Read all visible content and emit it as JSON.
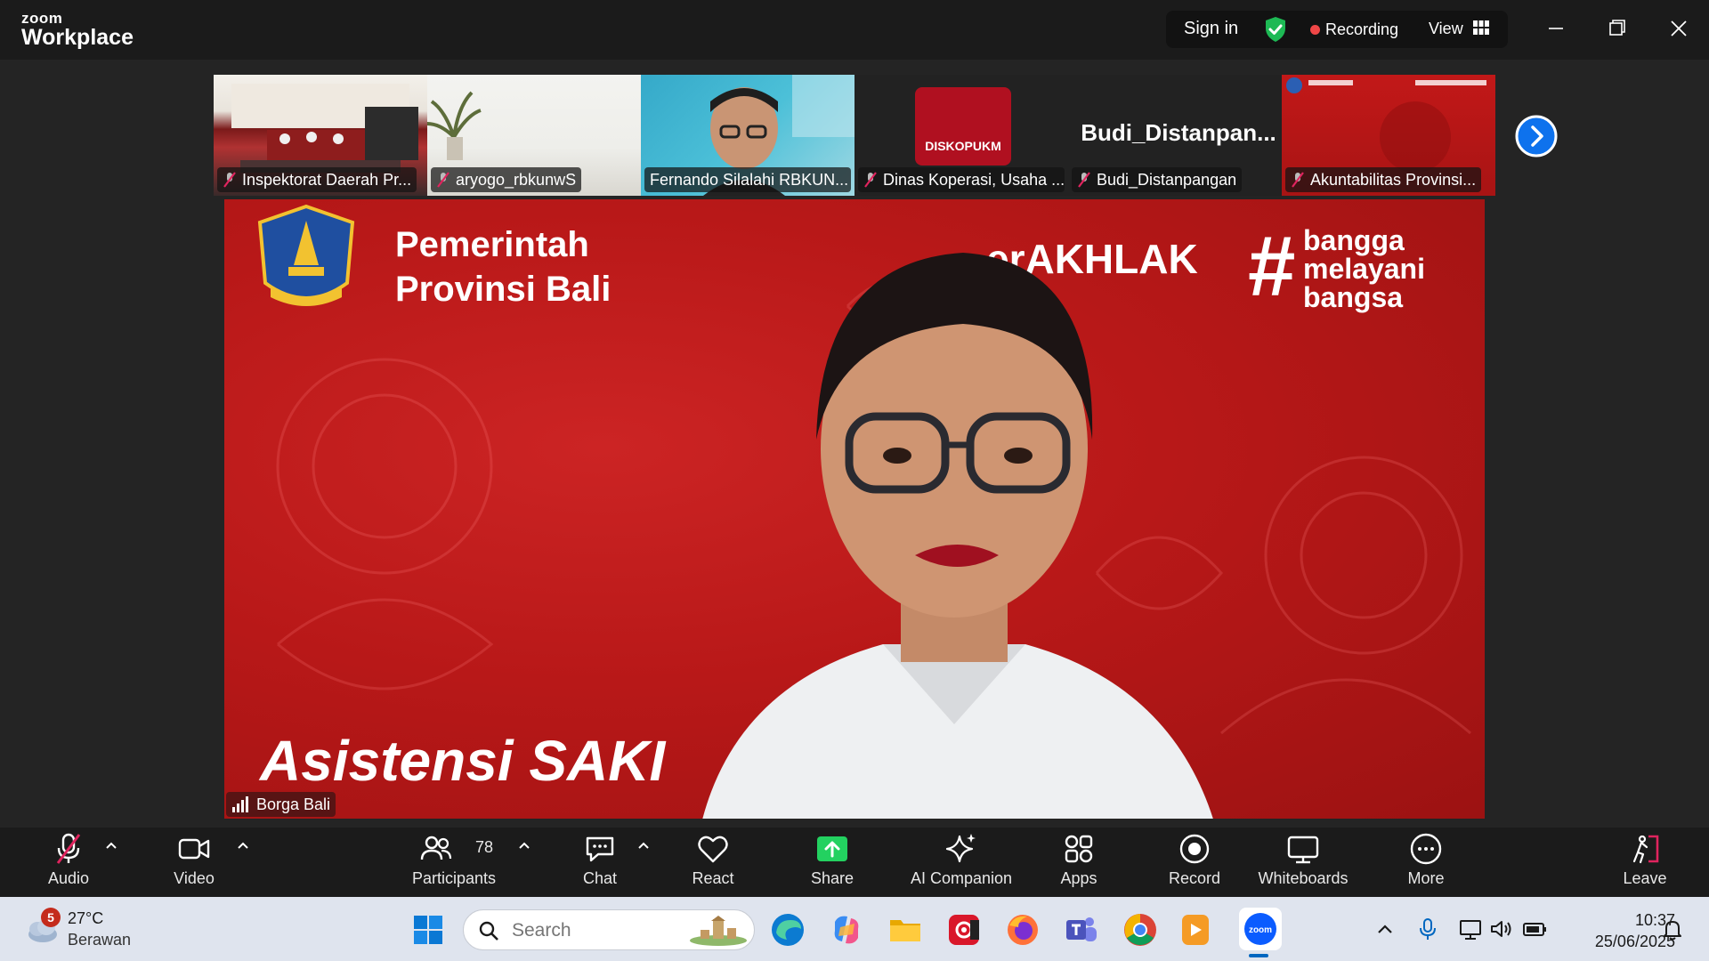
{
  "titlebar": {
    "brand_small": "zoom",
    "brand_big": "Workplace",
    "sign_in": "Sign in",
    "recording": "Recording",
    "view": "View",
    "colors": {
      "shield": "#1db954",
      "record_dot": "#f04747"
    }
  },
  "thumbnails": [
    {
      "name": "Inspektorat Daerah Pr..."
    },
    {
      "name": "aryogo_rbkunwS"
    },
    {
      "name": "Fernando Silalahi RBKUN..."
    },
    {
      "name": "Dinas Koperasi, Usaha ...",
      "logo_text": "DISKOPUKM"
    },
    {
      "name": "Budi_Distanpangan",
      "big_name": "Budi_Distanpan..."
    },
    {
      "name": "Akuntabilitas Provinsi..."
    }
  ],
  "main_video": {
    "speaker": "Borga Bali",
    "slide": {
      "line1": "Pemerintah",
      "line2": "Provinsi Bali",
      "berakhlak": "erAKHLAK",
      "hashtag": "#",
      "tag_line1": "bangga",
      "tag_line2": "melayani",
      "tag_line3": "bangsa",
      "bottom_text": "Asistensi SAKI"
    }
  },
  "toolbar": {
    "audio": "Audio",
    "video": "Video",
    "participants": "Participants",
    "participant_count": "78",
    "chat": "Chat",
    "react": "React",
    "share": "Share",
    "ai_companion": "AI Companion",
    "apps": "Apps",
    "record": "Record",
    "whiteboards": "Whiteboards",
    "more": "More",
    "leave": "Leave",
    "colors": {
      "share": "#23d160",
      "mute_slash": "#e0245e",
      "leave": "#e0245e"
    }
  },
  "taskbar": {
    "weather_badge": "5",
    "temperature": "27°C",
    "condition": "Berawan",
    "search_placeholder": "Search",
    "time": "10:37",
    "date": "25/06/2025"
  }
}
